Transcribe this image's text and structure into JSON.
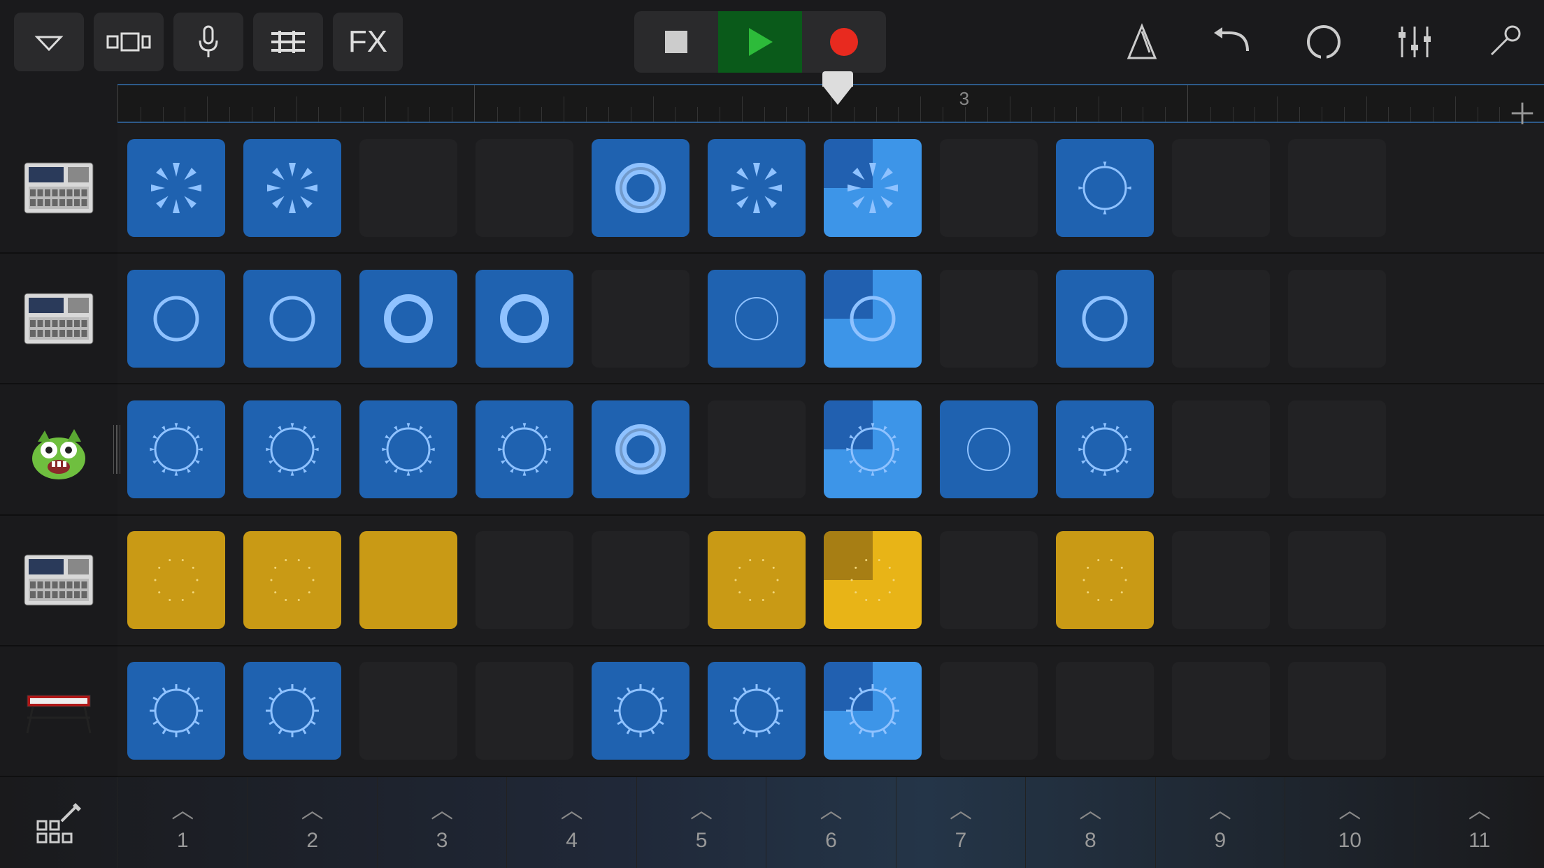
{
  "toolbar": {
    "fx_label": "FX"
  },
  "ruler": {
    "playhead_position_percent": 50.5,
    "marker_bar": "3",
    "marker_position_percent": 59
  },
  "columns": [
    "1",
    "2",
    "3",
    "4",
    "5",
    "6",
    "7",
    "8",
    "9",
    "10",
    "11"
  ],
  "tracks": [
    {
      "instrument": "drummachine",
      "cells": [
        {
          "t": "blue",
          "viz": "burst"
        },
        {
          "t": "blue",
          "viz": "burst"
        },
        {
          "t": "empty"
        },
        {
          "t": "empty"
        },
        {
          "t": "blue",
          "viz": "ring-thick"
        },
        {
          "t": "blue",
          "viz": "burst"
        },
        {
          "t": "active",
          "viz": "burst",
          "wedge": true
        },
        {
          "t": "empty"
        },
        {
          "t": "blue",
          "viz": "ring-seg"
        },
        {
          "t": "empty"
        },
        {
          "t": "empty"
        }
      ]
    },
    {
      "instrument": "drummachine",
      "cells": [
        {
          "t": "blue",
          "viz": "ring"
        },
        {
          "t": "blue",
          "viz": "ring"
        },
        {
          "t": "blue",
          "viz": "ring-solid"
        },
        {
          "t": "blue",
          "viz": "ring-solid"
        },
        {
          "t": "empty"
        },
        {
          "t": "blue",
          "viz": "ring-thin"
        },
        {
          "t": "active",
          "viz": "ring",
          "wedge": true
        },
        {
          "t": "empty"
        },
        {
          "t": "blue",
          "viz": "ring"
        },
        {
          "t": "empty"
        },
        {
          "t": "empty"
        }
      ]
    },
    {
      "instrument": "monster",
      "cells": [
        {
          "t": "blue",
          "viz": "ring-dots"
        },
        {
          "t": "blue",
          "viz": "ring-dots"
        },
        {
          "t": "blue",
          "viz": "ring-arrows"
        },
        {
          "t": "blue",
          "viz": "ring-arrows"
        },
        {
          "t": "blue",
          "viz": "ring-thick"
        },
        {
          "t": "empty"
        },
        {
          "t": "active",
          "viz": "ring-dots",
          "wedge": true
        },
        {
          "t": "blue",
          "viz": "ring-thin"
        },
        {
          "t": "blue",
          "viz": "ring-dots"
        },
        {
          "t": "empty"
        },
        {
          "t": "empty"
        }
      ]
    },
    {
      "instrument": "drummachine",
      "cells": [
        {
          "t": "yellow",
          "viz": "sparse"
        },
        {
          "t": "yellow",
          "viz": "sparse"
        },
        {
          "t": "yellow",
          "viz": "none"
        },
        {
          "t": "empty"
        },
        {
          "t": "empty"
        },
        {
          "t": "yellow",
          "viz": "sparse"
        },
        {
          "t": "yellow-active",
          "viz": "sparse",
          "wedge": true
        },
        {
          "t": "empty"
        },
        {
          "t": "yellow",
          "viz": "sparse"
        },
        {
          "t": "empty"
        },
        {
          "t": "empty"
        }
      ]
    },
    {
      "instrument": "keyboard",
      "cells": [
        {
          "t": "blue",
          "viz": "ring-spiky"
        },
        {
          "t": "blue",
          "viz": "ring-spiky"
        },
        {
          "t": "empty"
        },
        {
          "t": "empty"
        },
        {
          "t": "blue",
          "viz": "ring-spiky"
        },
        {
          "t": "blue",
          "viz": "ring-spiky"
        },
        {
          "t": "active",
          "viz": "ring-spiky",
          "wedge": true
        },
        {
          "t": "empty"
        },
        {
          "t": "empty"
        },
        {
          "t": "empty"
        },
        {
          "t": "empty"
        }
      ]
    }
  ]
}
